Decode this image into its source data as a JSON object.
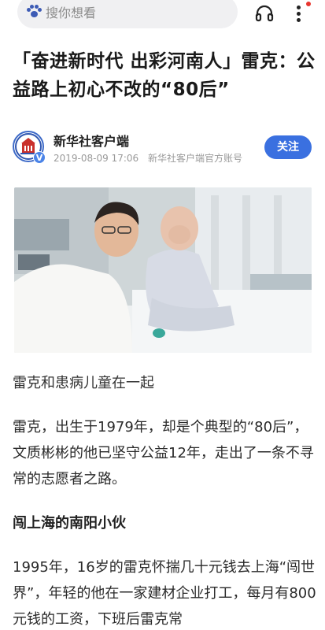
{
  "topbar": {
    "search_placeholder": "搜你想看",
    "icons": [
      "paw-icon",
      "headphone-icon",
      "more-vertical-icon"
    ],
    "notification_dot_color": "#e8352e"
  },
  "article": {
    "title": "「奋进新时代 出彩河南人」雷克：公益路上初心不改的“80后”",
    "author": {
      "name": "新华社客户端",
      "date": "2019-08-09 17:06",
      "account_type": "新华社客户端官方账号",
      "verified_badge": "V",
      "follow_label": "关注"
    },
    "photo_caption": "雷克和患病儿童在一起",
    "paragraph1": "雷克，出生于1979年，却是个典型的“80后”，文质彬彬的他已坚守公益12年，走出了一条不寻常的志愿者之路。",
    "subheading": "闯上海的南阳小伙",
    "paragraph2": "1995年，16岁的雷克怀揣几十元钱去上海“闯世界”，年轻的他在一家建材企业打工，每月有800元钱的工资，下班后雷克常"
  },
  "colors": {
    "accent": "#3a70e0",
    "search_bg": "#f0f0f2"
  }
}
